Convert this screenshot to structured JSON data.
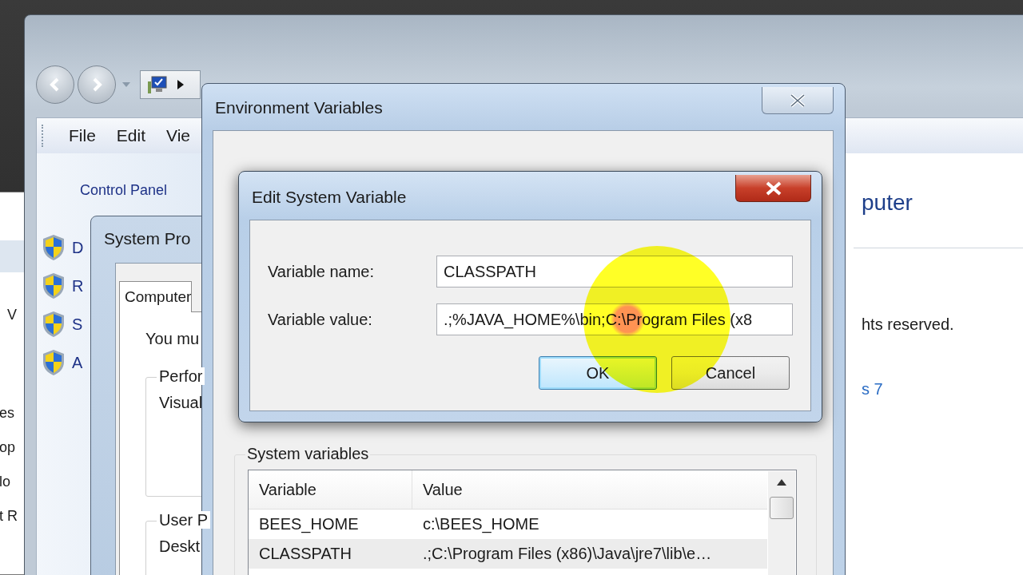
{
  "back_window": {
    "items": [
      "V",
      "es",
      "op",
      "lo",
      "t R"
    ]
  },
  "control_panel": {
    "menu": [
      "File",
      "Edit",
      "Vie"
    ],
    "breadcrumb": "Control Panel",
    "tasks": [
      "D",
      "R",
      "S",
      "A"
    ],
    "heading": "puter",
    "copyright": "hts reserved.",
    "link": "s 7"
  },
  "system_properties": {
    "title": "System Pro",
    "tabs": [
      {
        "label": "Computer",
        "selected": true
      }
    ],
    "intro": "You mu",
    "groups": [
      {
        "label": "Perfor",
        "text": "Visual"
      },
      {
        "label": "User P",
        "text": "Deskt"
      }
    ]
  },
  "environment_variables": {
    "title": "Environment Variables",
    "system_variables": {
      "label": "System variables",
      "columns": [
        "Variable",
        "Value"
      ],
      "rows": [
        {
          "variable": "BEES_HOME",
          "value": "c:\\BEES_HOME",
          "selected": false
        },
        {
          "variable": "CLASSPATH",
          "value": ".;C:\\Program Files (x86)\\Java\\jre7\\lib\\e…",
          "selected": true
        }
      ]
    }
  },
  "edit_dialog": {
    "title": "Edit System Variable",
    "fields": [
      {
        "label": "Variable name:",
        "value": "CLASSPATH"
      },
      {
        "label": "Variable value:",
        "value": ".;%JAVA_HOME%\\bin;C:\\Program Files (x8"
      }
    ],
    "buttons": [
      {
        "label": "OK",
        "focused": true
      },
      {
        "label": "Cancel",
        "focused": false
      }
    ]
  }
}
